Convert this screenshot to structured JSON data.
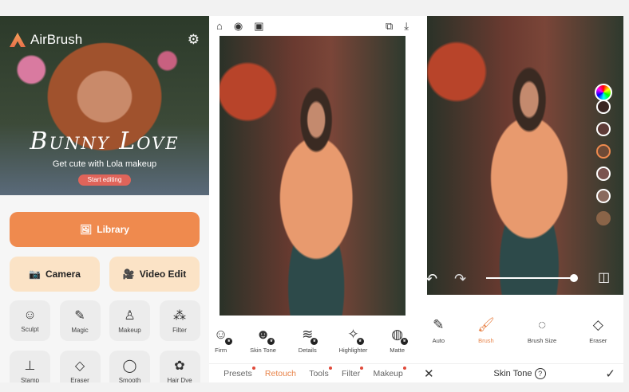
{
  "home": {
    "app_name": "AirBrush",
    "banner_title": "Bunny Love",
    "banner_subtitle": "Get cute with Lola makeup",
    "banner_button": "Start editing",
    "library": "Library",
    "camera": "Camera",
    "video_edit": "Video Edit",
    "tools": [
      {
        "label": "Sculpt",
        "icon": "☺"
      },
      {
        "label": "Magic",
        "icon": "✎"
      },
      {
        "label": "Makeup",
        "icon": "♙"
      },
      {
        "label": "Filter",
        "icon": "⁂"
      },
      {
        "label": "Stamp",
        "icon": "⊥"
      },
      {
        "label": "Eraser",
        "icon": "◇"
      },
      {
        "label": "Smooth",
        "icon": "◯"
      },
      {
        "label": "Hair Dye",
        "icon": "✿"
      }
    ]
  },
  "retouch": {
    "tools": [
      {
        "label": "Firm",
        "icon": "☺"
      },
      {
        "label": "Skin Tone",
        "icon": "☻"
      },
      {
        "label": "Details",
        "icon": "≋"
      },
      {
        "label": "Highlighter",
        "icon": "✧"
      },
      {
        "label": "Matte",
        "icon": "◍"
      }
    ],
    "tabs": [
      {
        "label": "Presets",
        "dot": true
      },
      {
        "label": "Retouch",
        "active": true,
        "dot": false
      },
      {
        "label": "Tools",
        "dot": true
      },
      {
        "label": "Filter",
        "dot": true
      },
      {
        "label": "Makeup",
        "dot": true
      }
    ]
  },
  "skin_tone": {
    "title": "Skin Tone",
    "tools": [
      {
        "label": "Auto",
        "icon": "✎"
      },
      {
        "label": "Brush",
        "icon": "🖌",
        "active": true
      },
      {
        "label": "Brush Size",
        "icon": "◌"
      },
      {
        "label": "Eraser",
        "icon": "◇"
      }
    ],
    "swatches": [
      "#3a2522",
      "#5e3a36",
      "#6e4a36",
      "#7a5450",
      "#8a6a5e",
      "#8a6448"
    ],
    "selected_swatch": 2,
    "slider_value": 1.0
  },
  "colors": {
    "accent": "#ef8a4e",
    "active_tab": "#e8844a"
  }
}
